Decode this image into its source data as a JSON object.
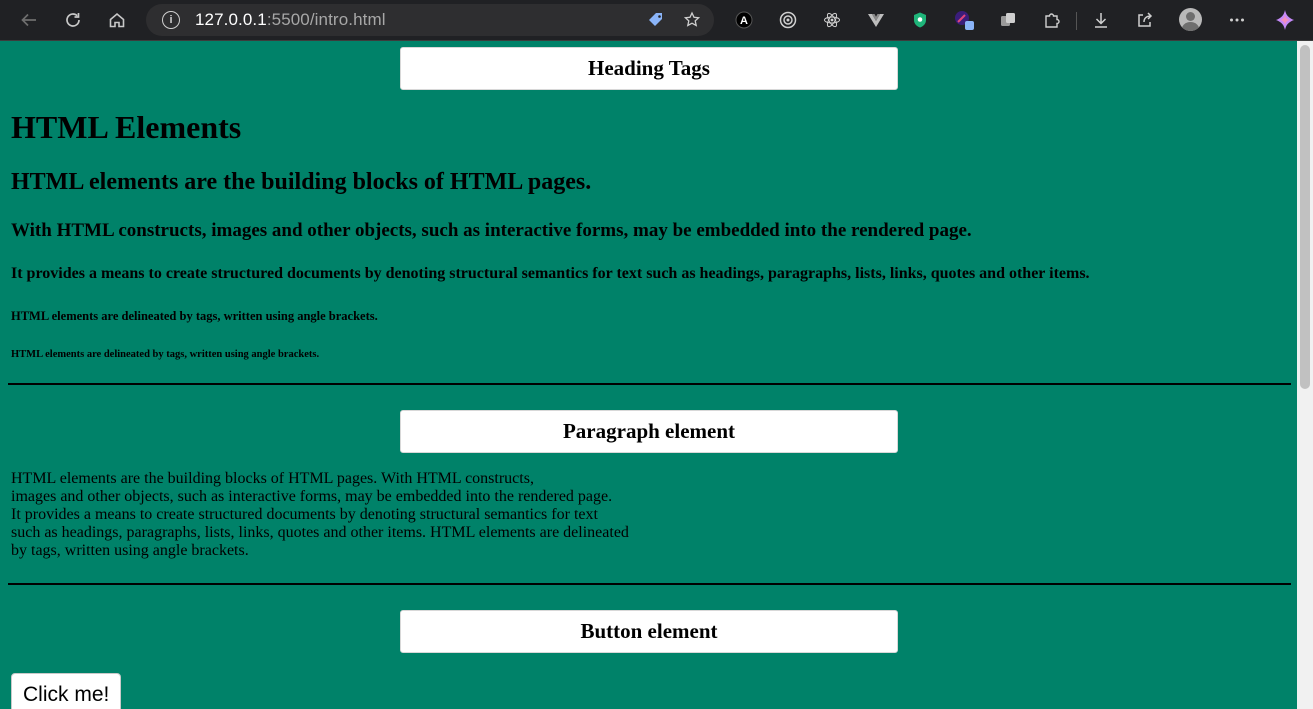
{
  "browser": {
    "url_host": "127.0.0.1",
    "url_rest": ":5500/intro.html",
    "icons": {
      "back": "back-arrow-icon",
      "reload": "reload-icon",
      "home": "home-icon",
      "site_info": "site-info-icon",
      "tag": "tag-icon",
      "bookmark": "star-add-icon",
      "extensions_bar": [
        "extension-a-icon",
        "extension-target-icon",
        "react-devtools-icon",
        "vue-devtools-icon",
        "shield-extension-icon",
        "color-picker-extension-icon",
        "tabs-extension-icon",
        "puzzle-extensions-icon"
      ],
      "download": "download-icon",
      "share": "share-icon",
      "profile": "profile-avatar-icon",
      "menu": "more-menu-icon",
      "ai": "sparkle-ai-icon"
    }
  },
  "page": {
    "headings_section": {
      "label": "Heading Tags",
      "h1": "HTML Elements",
      "h2": "HTML elements are the building blocks of HTML pages.",
      "h3": "With HTML constructs, images and other objects, such as interactive forms, may be embedded into the rendered page.",
      "h4": "It provides a means to create structured documents by denoting structural semantics for text such as headings, paragraphs, lists, links, quotes and other items.",
      "h5": "HTML elements are delineated by tags, written using angle brackets.",
      "h6": "HTML elements are delineated by tags, written using angle brackets."
    },
    "paragraph_section": {
      "label": "Paragraph element",
      "lines": [
        "HTML elements are the building blocks of HTML pages. With HTML constructs,",
        "images and other objects, such as interactive forms, may be embedded into the rendered page.",
        "It provides a means to create structured documents by denoting structural semantics for text",
        "such as headings, paragraphs, lists, links, quotes and other items. HTML elements are delineated",
        "by tags, written using angle brackets."
      ]
    },
    "button_section": {
      "label": "Button element",
      "button_label": "Click me!"
    }
  },
  "colors": {
    "page_background": "#008269",
    "chrome_background": "#202124"
  }
}
